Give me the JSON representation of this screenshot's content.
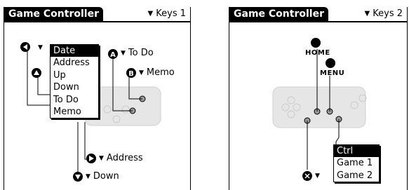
{
  "panel1": {
    "title": "Game Controller",
    "keys_label": "Keys 1",
    "labels": {
      "top_right_a": "To Do",
      "top_right_b": "Memo",
      "bottom_c": "Address",
      "bottom_d": "Down"
    },
    "dropdown": {
      "items": [
        "Date",
        "Address",
        "Up",
        "Down",
        "To Do",
        "Memo"
      ],
      "selected": "Date"
    }
  },
  "panel2": {
    "title": "Game Controller",
    "keys_label": "Keys 2",
    "home_label": "HOME",
    "menu_label": "MENU",
    "dropdown": {
      "items": [
        "Ctrl",
        "Game 1",
        "Game 2"
      ],
      "selected": "Ctrl"
    }
  },
  "icons": {
    "arrow": "down-triangle",
    "buttons": [
      "left-arrow-button",
      "up-arrow-button",
      "a-button",
      "b-button",
      "right-arrow-button",
      "down-arrow-button",
      "x-button"
    ]
  }
}
